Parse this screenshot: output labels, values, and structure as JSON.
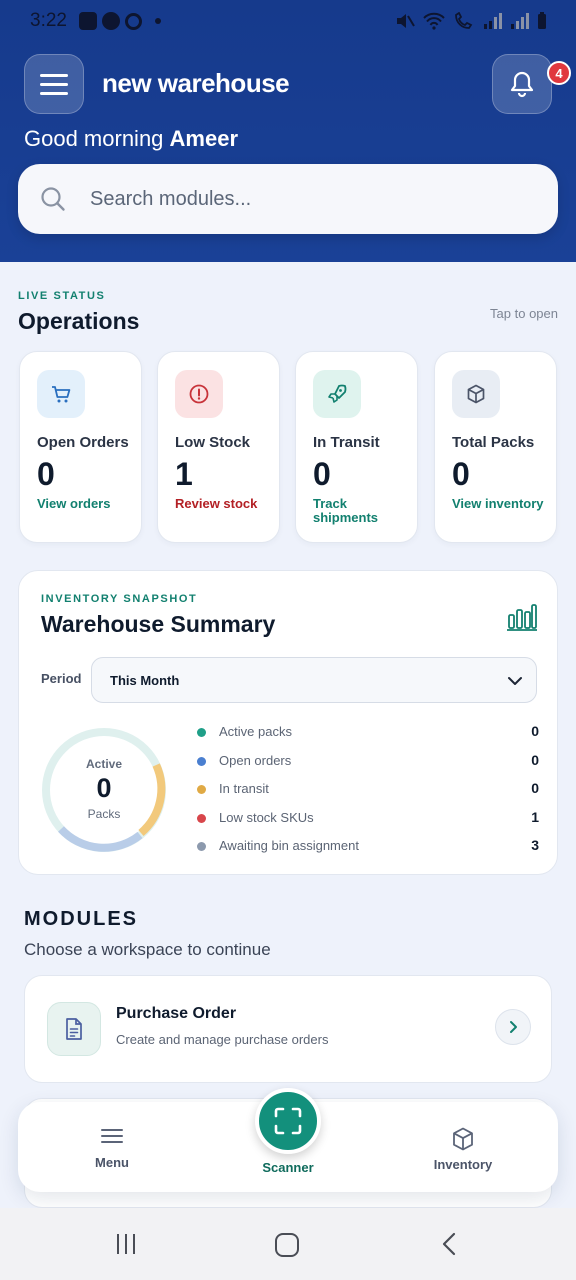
{
  "status_bar": {
    "time": "3:22"
  },
  "header": {
    "app_name": "new warehouse",
    "notification_count": "4",
    "greeting_prefix": "Good morning",
    "user_name": "Ameer",
    "search_placeholder": "Search modules..."
  },
  "operations": {
    "eyebrow": "LIVE STATUS",
    "title": "Operations",
    "hint": "Tap to open",
    "cards": [
      {
        "label": "Open Orders",
        "value": "0",
        "action": "View orders",
        "icon": "cart-icon",
        "icon_bg": "#e3f0fb",
        "action_color": "#12806f"
      },
      {
        "label": "Low Stock",
        "value": "1",
        "action": "Review stock",
        "icon": "alert-circle-icon",
        "icon_bg": "#fbe2e3",
        "action_color": "#b32025"
      },
      {
        "label": "In Transit",
        "value": "0",
        "action": "Track shipments",
        "icon": "rocket-icon",
        "icon_bg": "#dff3ee",
        "action_color": "#12806f"
      },
      {
        "label": "Total Packs",
        "value": "0",
        "action": "View inventory",
        "icon": "box-icon",
        "icon_bg": "#e8edf4",
        "action_color": "#12806f"
      }
    ]
  },
  "summary": {
    "eyebrow": "INVENTORY SNAPSHOT",
    "title": "Warehouse Summary",
    "period_label": "Period",
    "period_value": "This Month",
    "donut": {
      "label": "Active",
      "value": "0",
      "unit": "Packs"
    },
    "legend": [
      {
        "name": "Active packs",
        "value": "0",
        "color": "#1f9f88"
      },
      {
        "name": "Open orders",
        "value": "0",
        "color": "#4a7fd0"
      },
      {
        "name": "In transit",
        "value": "0",
        "color": "#e0aa45"
      },
      {
        "name": "Low stock SKUs",
        "value": "1",
        "color": "#d8464b"
      },
      {
        "name": "Awaiting bin assignment",
        "value": "3",
        "color": "#8c99ad"
      }
    ]
  },
  "modules": {
    "title": "MODULES",
    "subtitle": "Choose a workspace to continue",
    "items": [
      {
        "name": "Purchase Order",
        "description": "Create and manage purchase orders",
        "icon": "document-icon"
      }
    ]
  },
  "bottom_nav": {
    "menu": "Menu",
    "scanner": "Scanner",
    "inventory": "Inventory"
  },
  "colors": {
    "header_blue": "#163a8c",
    "accent_teal": "#13907c",
    "danger_red": "#b32025"
  }
}
